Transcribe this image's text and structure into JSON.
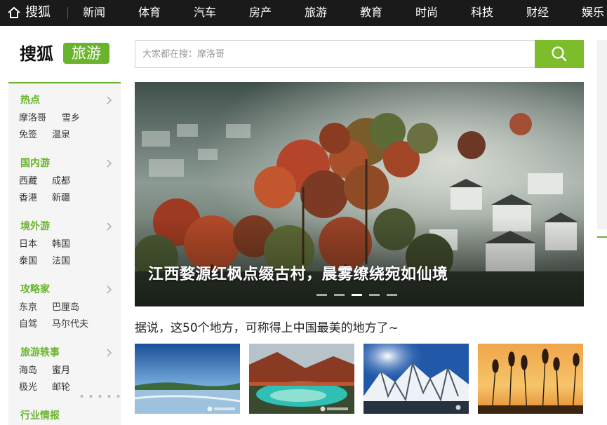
{
  "topnav": {
    "brand": "搜狐",
    "items": [
      "新闻",
      "体育",
      "汽车",
      "房产",
      "旅游",
      "教育",
      "时尚",
      "科技",
      "财经",
      "娱乐"
    ]
  },
  "logo": {
    "main": "搜狐",
    "badge": "旅游"
  },
  "search": {
    "placeholder": "大家都在搜：摩洛哥"
  },
  "sidebar": [
    {
      "title": "热点",
      "links": [
        "摩洛哥",
        "雪乡",
        "免签",
        "温泉"
      ]
    },
    {
      "title": "国内游",
      "links": [
        "西藏",
        "成都",
        "香港",
        "新疆"
      ]
    },
    {
      "title": "境外游",
      "links": [
        "日本",
        "韩国",
        "泰国",
        "法国"
      ]
    },
    {
      "title": "攻略家",
      "links": [
        "东京",
        "巴厘岛",
        "自驾",
        "马尔代夫"
      ]
    },
    {
      "title": "旅游轶事",
      "links": [
        "海岛",
        "蜜月",
        "极光",
        "邮轮"
      ]
    },
    {
      "title": "行业情报",
      "links": []
    }
  ],
  "hero": {
    "caption": "江西婺源红枫点缀古村，晨雾缭绕宛如仙境",
    "slide_count": 5,
    "active_slide": 3
  },
  "headline": "据说，这50个地方，可称得上中国最美的地方了~",
  "thumbnails": [
    "lake-grassland",
    "colorful-lake-forest",
    "snow-mountains-sun",
    "reeds-sunset"
  ],
  "colors": {
    "accent": "#6ab42d",
    "search_button": "#7dbd2c",
    "topbar": "#1a1a1a"
  }
}
